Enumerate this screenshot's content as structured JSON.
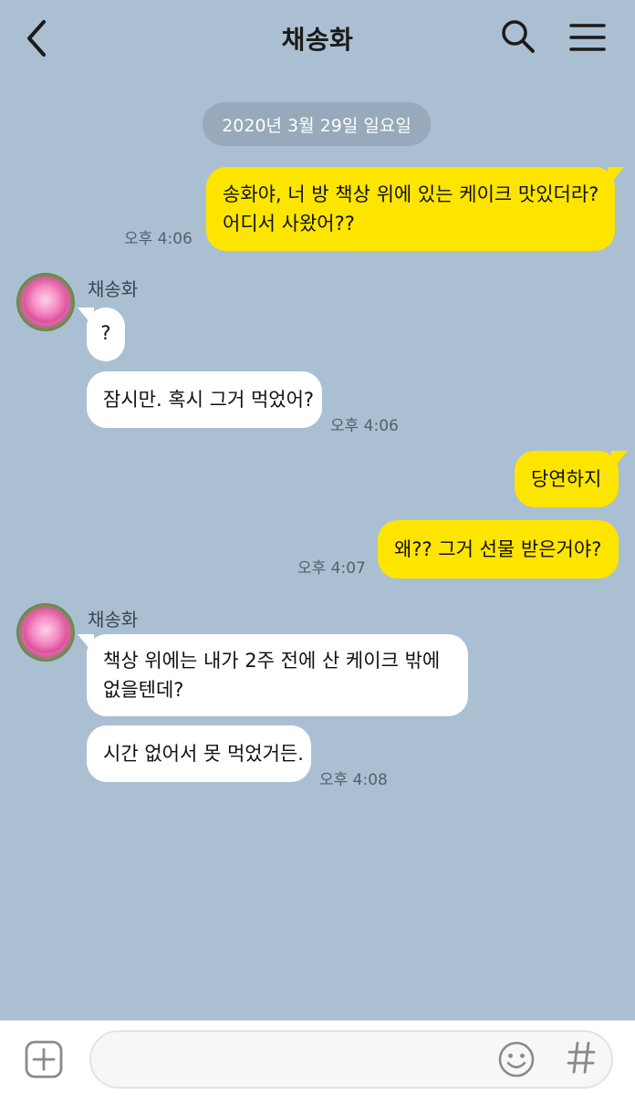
{
  "header": {
    "title": "채송화",
    "back_icon": "chevron-left-icon",
    "search_icon": "search-icon",
    "menu_icon": "hamburger-menu-icon"
  },
  "date_divider": "2020년 3월 29일 일요일",
  "messages": [
    {
      "from": "me",
      "lines": [
        "송화야, 너 방 책상 위에 있는 케이크 맛있더라?",
        "어디서 사왔어??"
      ],
      "time": "오후 4:06"
    },
    {
      "from": "other",
      "sender": "채송화",
      "text": "?"
    },
    {
      "from": "other",
      "text": "잠시만. 혹시 그거 먹었어?",
      "time": "오후 4:06"
    },
    {
      "from": "me",
      "text": "당연하지"
    },
    {
      "from": "me",
      "text": "왜?? 그거 선물 받은거야?",
      "time": "오후 4:07"
    },
    {
      "from": "other",
      "sender": "채송화",
      "lines": [
        "책상 위에는 내가 2주 전에 산 케이크 밖에",
        "없을텐데?"
      ]
    },
    {
      "from": "other",
      "text": "시간 없어서 못 먹었거든.",
      "time": "오후 4:08"
    }
  ],
  "input": {
    "value": "",
    "placeholder": "",
    "plus_icon": "plus-square-icon",
    "emoji_icon": "emoji-icon",
    "hash_icon": "hashtag-icon"
  },
  "colors": {
    "background": "#abbfd2",
    "my_bubble": "#fee500",
    "other_bubble": "#ffffff",
    "date_pill": "#97a9ba"
  }
}
